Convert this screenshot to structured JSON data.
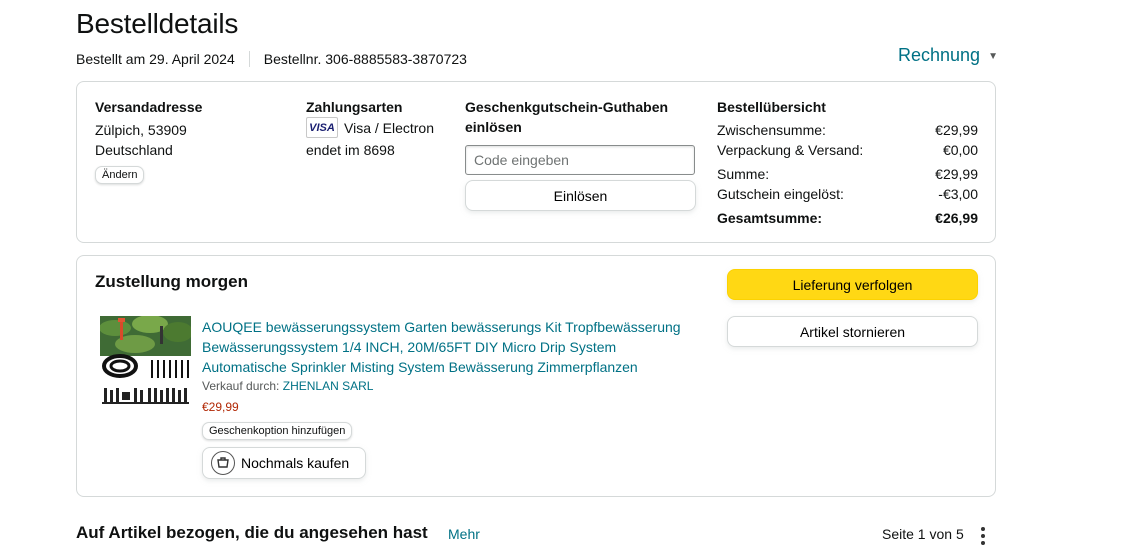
{
  "header": {
    "title": "Bestelldetails",
    "order_date": "Bestellt am 29. April 2024",
    "order_number": "Bestellnr. 306-8885583-3870723",
    "invoice_label": "Rechnung"
  },
  "shipping": {
    "title": "Versandadresse",
    "line1": "Zülpich, 53909",
    "line2": "Deutschland",
    "change_label": "Ändern"
  },
  "payment": {
    "title": "Zahlungsarten",
    "card_brand": "VISA",
    "card_name": "Visa / Electron",
    "card_ending": "endet im 8698"
  },
  "gift_card": {
    "title_line1": "Geschenkgutschein-Guthaben",
    "title_line2": "einlösen",
    "placeholder": "Code eingeben",
    "redeem_label": "Einlösen"
  },
  "order_summary": {
    "title": "Bestellübersicht",
    "rows": [
      {
        "label": "Zwischensumme:",
        "value": "€29,99"
      },
      {
        "label": "Verpackung & Versand:",
        "value": "€0,00"
      },
      {
        "label": "Summe:",
        "value": "€29,99"
      },
      {
        "label": "Gutschein eingelöst:",
        "value": "-€3,00"
      },
      {
        "label": "Gesamtsumme:",
        "value": "€26,99"
      }
    ]
  },
  "delivery": {
    "title": "Zustellung morgen",
    "track_label": "Lieferung verfolgen",
    "cancel_label": "Artikel stornieren",
    "product": {
      "name": "AOUQEE bewässerungssystem Garten bewässerungs Kit Tropfbewässerung Bewässerungssystem 1/4 INCH, 20M/65FT DIY Micro Drip System Automatische Sprinkler Misting System Bewässerung Zimmerpflanzen",
      "seller_prefix": "Verkauf durch:",
      "seller_name": "ZHENLAN SARL",
      "price": "€29,99",
      "gift_label": "Geschenkoption hinzufügen",
      "buy_again_label": "Nochmals kaufen"
    }
  },
  "related": {
    "title": "Auf Artikel bezogen, die du angesehen hast",
    "more_label": "Mehr",
    "page_label": "Seite 1 von 5"
  },
  "colors": {
    "link": "#007185",
    "price": "#b12704",
    "primary_button": "#ffd814",
    "border": "#d5d9d9"
  }
}
